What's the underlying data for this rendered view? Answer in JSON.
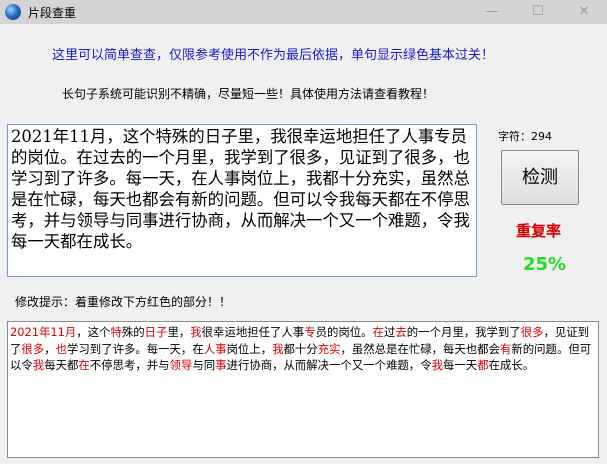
{
  "window": {
    "title": "片段查重",
    "min_glyph": "—",
    "max_glyph": "☐",
    "close_glyph": "✕"
  },
  "notice_line1": "这里可以简单查查，仅限参考使用不作为最后依据，单句显示绿色基本过关！",
  "notice_line2": "长句子系统可能识别不精确，尽量短一些！具体使用方法请查看教程！",
  "input_text": "2021年11月，这个特殊的日子里，我很幸运地担任了人事专员的岗位。在过去的一个月里，我学到了很多，见证到了很多，也学习到了许多。每一天，在人事岗位上，我都十分充实，虽然总是在忙碌，每天也都会有新的问题。但可以令我每天都在不停思考，并与领导与同事进行协商，从而解决一个又一个难题，令我每一天都在成长。",
  "char_count": {
    "label": "字符：",
    "value": "294"
  },
  "check_button": "检测",
  "repeat_rate": {
    "label": "重复率",
    "value": "25%"
  },
  "hint": "修改提示：着重修改下方红色的部分！！",
  "result_segments": [
    {
      "t": "2021年11月",
      "red": true
    },
    {
      "t": "，这个",
      "red": false
    },
    {
      "t": "特",
      "red": true
    },
    {
      "t": "殊的",
      "red": false
    },
    {
      "t": "日子",
      "red": true
    },
    {
      "t": "里，",
      "red": false
    },
    {
      "t": "我",
      "red": true
    },
    {
      "t": "很幸运地担任了人事",
      "red": false
    },
    {
      "t": "专",
      "red": true
    },
    {
      "t": "员的岗位。",
      "red": false
    },
    {
      "t": "在",
      "red": true
    },
    {
      "t": "过",
      "red": false
    },
    {
      "t": "去",
      "red": true
    },
    {
      "t": "的一个月里，我学到了",
      "red": false
    },
    {
      "t": "很多",
      "red": true
    },
    {
      "t": "，见证到了",
      "red": false
    },
    {
      "t": "很多",
      "red": true
    },
    {
      "t": "，",
      "red": false
    },
    {
      "t": "也",
      "red": true
    },
    {
      "t": "学习到了许多。每一天，在",
      "red": false
    },
    {
      "t": "人事",
      "red": true
    },
    {
      "t": "岗位上，",
      "red": false
    },
    {
      "t": "我",
      "red": true
    },
    {
      "t": "都十分",
      "red": false
    },
    {
      "t": "充实",
      "red": true
    },
    {
      "t": "，虽然总是在忙碌，每天也都会",
      "red": false
    },
    {
      "t": "有",
      "red": true
    },
    {
      "t": "新的问题。但可以令",
      "red": false
    },
    {
      "t": "我",
      "red": true
    },
    {
      "t": "每天都",
      "red": false
    },
    {
      "t": "在",
      "red": true
    },
    {
      "t": "不停思考，并与",
      "red": false
    },
    {
      "t": "领导",
      "red": true
    },
    {
      "t": "与同",
      "red": false
    },
    {
      "t": "事",
      "red": true
    },
    {
      "t": "进行协商，从而解决一个又一个难题，令",
      "red": false
    },
    {
      "t": "我",
      "red": true
    },
    {
      "t": "每一天",
      "red": false
    },
    {
      "t": "都",
      "red": true
    },
    {
      "t": "在成长。",
      "red": false
    }
  ],
  "colors": {
    "notice": "#1a1acc",
    "rate_label": "#d40000",
    "rate_value": "#22dd22",
    "highlight": "#e00000"
  }
}
